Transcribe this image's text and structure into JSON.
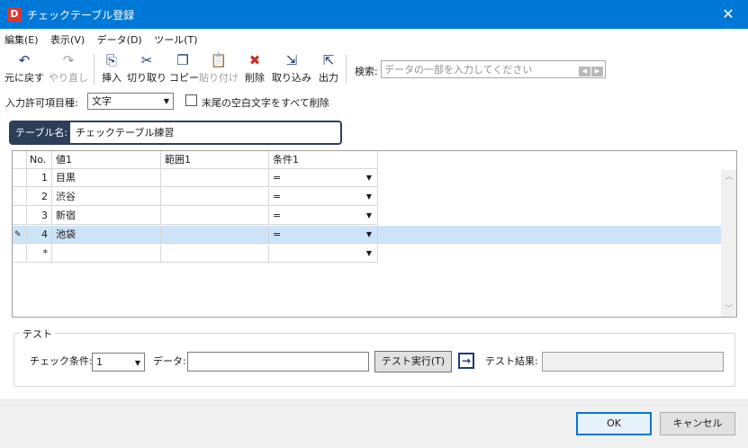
{
  "window": {
    "title": "チェックテーブル登録",
    "app_icon_letter": "D"
  },
  "menu": [
    "編集(E)",
    "表示(V)",
    "データ(D)",
    "ツール(T)"
  ],
  "toolbar": {
    "undo": "元に戻す",
    "redo": "やり直し",
    "insert": "挿入",
    "cut": "切り取り",
    "copy": "コピー",
    "paste": "貼り付け",
    "delete": "削除",
    "import": "取り込み",
    "export": "出力"
  },
  "search": {
    "label": "検索:",
    "placeholder": "データの一部を入力してください"
  },
  "input_type": {
    "label": "入力許可項目種:",
    "value": "文字"
  },
  "trim_option": {
    "label": "末尾の空白文字をすべて削除",
    "checked": false
  },
  "table_name": {
    "label": "テーブル名:",
    "value": "チェックテーブル練習"
  },
  "grid": {
    "headers": [
      "No.",
      "値1",
      "範囲1",
      "条件1"
    ],
    "rows": [
      {
        "no": "1",
        "value": "目黒",
        "range": "",
        "cond": "="
      },
      {
        "no": "2",
        "value": "渋谷",
        "range": "",
        "cond": "="
      },
      {
        "no": "3",
        "value": "新宿",
        "range": "",
        "cond": "="
      },
      {
        "no": "4",
        "value": "池袋",
        "range": "",
        "cond": "="
      },
      {
        "no": "*",
        "value": "",
        "range": "",
        "cond": ""
      }
    ],
    "selected_row": 4
  },
  "test": {
    "legend": "テスト",
    "cond_label": "チェック条件:",
    "cond_value": "1",
    "data_label": "データ:",
    "data_value": "",
    "exec_button": "テスト実行(T)",
    "result_label": "テスト結果:",
    "result_value": ""
  },
  "footer": {
    "ok": "OK",
    "cancel": "キャンセル"
  },
  "colors": {
    "titlebar": "#0078d7",
    "table_name_bg": "#2d3e5a",
    "selected_row": "#cde3f7"
  }
}
